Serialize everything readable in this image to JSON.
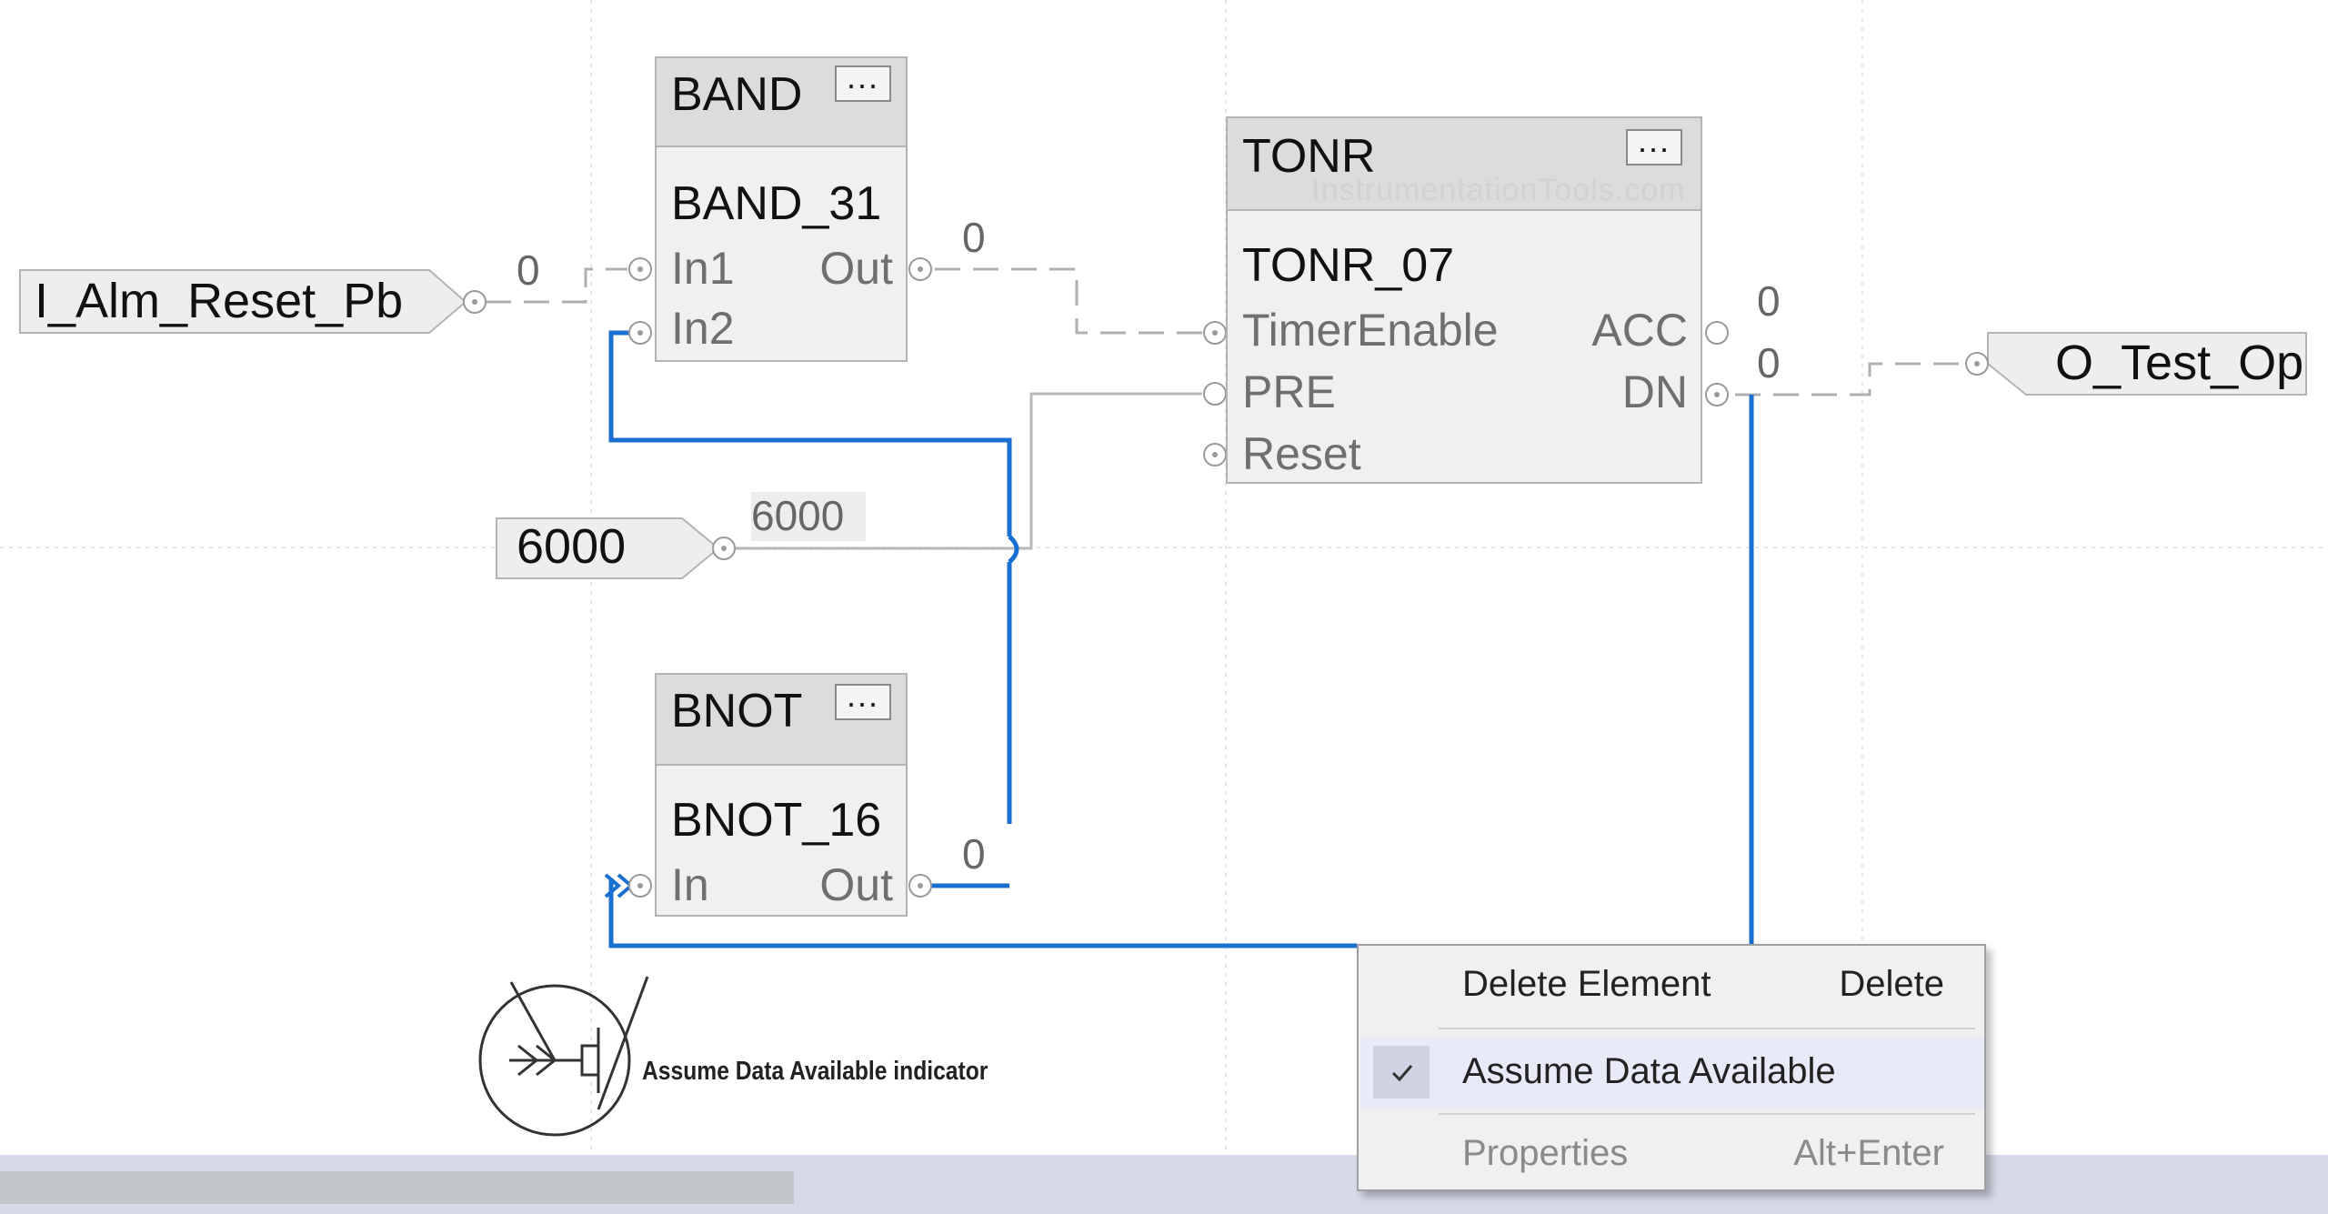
{
  "blocks": {
    "band": {
      "type": "BAND",
      "more": "...",
      "name": "BAND_31",
      "in1": "In1",
      "in2": "In2",
      "out": "Out",
      "out_value": "0"
    },
    "tonr": {
      "type": "TONR",
      "more": "...",
      "name": "TONR_07",
      "timer_enable": "TimerEnable",
      "pre": "PRE",
      "reset": "Reset",
      "acc": "ACC",
      "dn": "DN",
      "acc_value": "0",
      "dn_value": "0"
    },
    "bnot": {
      "type": "BNOT",
      "more": "...",
      "name": "BNOT_16",
      "in": "In",
      "out": "Out",
      "out_value": "0"
    }
  },
  "watermark": "InstrumentationTools.com",
  "input_refs": {
    "reset_pb": {
      "tag": "I_Alm_Reset_Pb",
      "value": "0"
    },
    "preset_const": {
      "tag": "6000",
      "value": "6000"
    }
  },
  "output_refs": {
    "test_op": {
      "tag": "O_Test_Op"
    }
  },
  "legend": {
    "label": "Assume Data Available indicator"
  },
  "context_menu": {
    "items": [
      {
        "label": "Delete Element",
        "shortcut": "Delete",
        "checked": false,
        "enabled": true
      },
      {
        "label": "Assume Data Available",
        "shortcut": "",
        "checked": true,
        "enabled": true
      },
      {
        "label": "Properties",
        "shortcut": "Alt+Enter",
        "checked": false,
        "enabled": false
      }
    ]
  },
  "colors": {
    "selected_wire": "#1a6fd0",
    "wire": "#b0b0b0",
    "block_fill": "#f0f0f0",
    "block_header": "#dcdcdc",
    "menu_check_bg": "#cfd3e4"
  }
}
